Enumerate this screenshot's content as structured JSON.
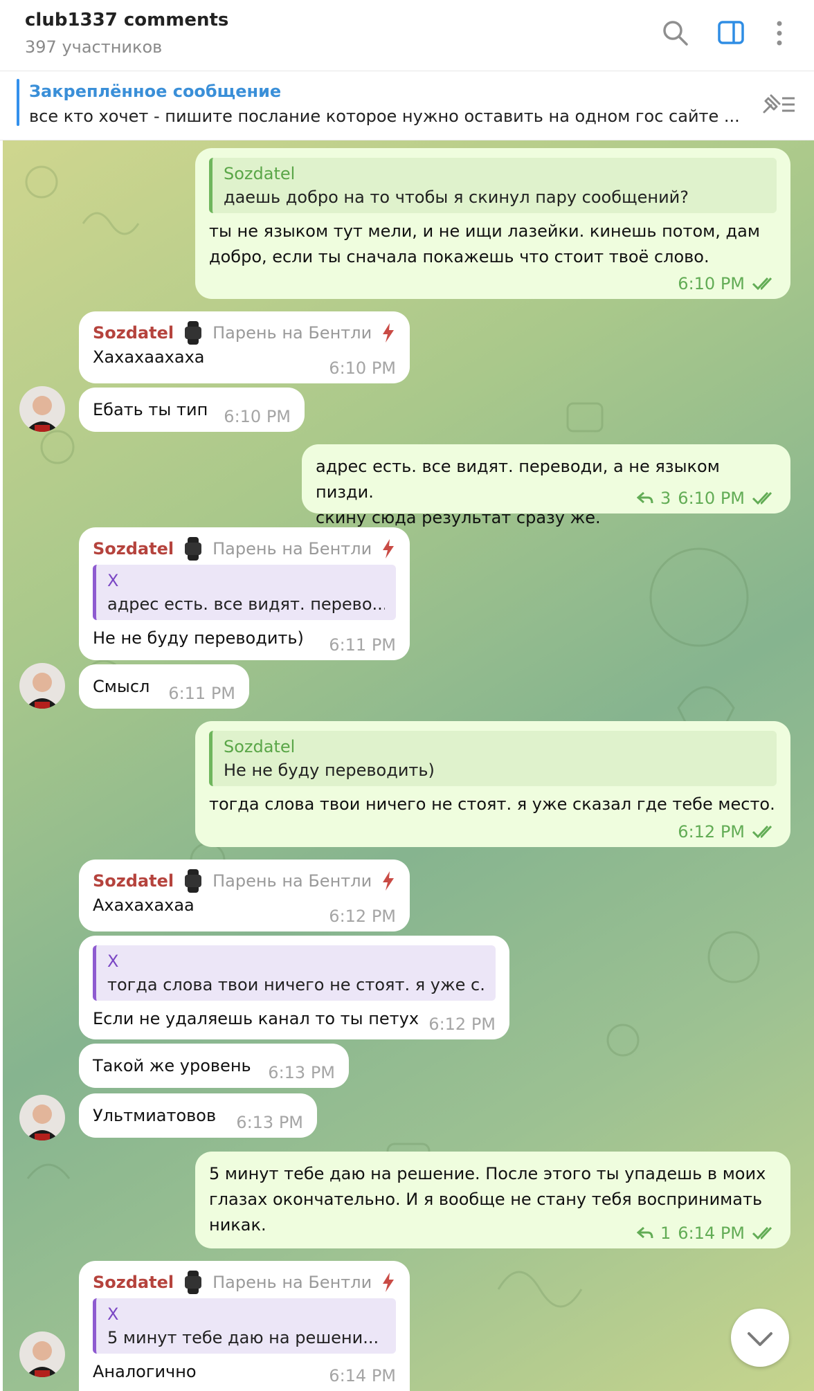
{
  "header": {
    "title": "club1337 comments",
    "subtitle": "397 участников",
    "icons": [
      "search-icon",
      "sidebar-icon",
      "more-icon"
    ]
  },
  "pinned": {
    "title": "Закреплённое сообщение",
    "text": "все кто хочет - пишите послание которое нужно оставить на одном гос сайте ...",
    "icon": "pin-list-icon"
  },
  "colors": {
    "accent": "#3390ec",
    "outgoing": "#effdde",
    "incoming": "#ffffff",
    "sender": "#b5433d",
    "check": "#62ac55"
  },
  "messages": [
    {
      "quote_name": "Sozdatel",
      "quote_text": "даешь добро на то чтобы я скинул пару сообщений?",
      "text": "ты не языком тут мели, и не ищи лазейки. кинешь потом, дам\nдобро, если ты сначала покажешь что стоит твоё слово.",
      "time": "6:10 PM"
    },
    {
      "sender": "Sozdatel",
      "rank": "Парень на Бентли",
      "text": "Хахахаахаха",
      "time": "6:10 PM"
    },
    {
      "text": "Ебать ты тип",
      "time": "6:10 PM"
    },
    {
      "text": "адрес есть. все видят. переводи, а не языком пизди.\nскину сюда результат сразу же.",
      "replies": "3",
      "time": "6:10 PM"
    },
    {
      "sender": "Sozdatel",
      "rank": "Парень на Бентли",
      "quote_name": "X",
      "quote_text": "адрес есть. все видят. перево...",
      "text": "Не не буду переводить)",
      "time": "6:11 PM"
    },
    {
      "text": "Смысл",
      "time": "6:11 PM"
    },
    {
      "quote_name": "Sozdatel",
      "quote_text": "Не не буду переводить)",
      "text": "тогда слова твои ничего не стоят. я уже сказал где тебе место.",
      "time": "6:12 PM"
    },
    {
      "sender": "Sozdatel",
      "rank": "Парень на Бентли",
      "text": "Ахахахахаа",
      "time": "6:12 PM"
    },
    {
      "quote_name": "X",
      "quote_text": "тогда слова твои ничего не стоят. я уже с...",
      "text": "Если не удаляешь канал то ты петух",
      "time": "6:12 PM"
    },
    {
      "text": "Такой же уровень",
      "time": "6:13 PM"
    },
    {
      "text": "Ультмиатовов",
      "time": "6:13 PM"
    },
    {
      "text": "5 минут тебе даю на решение. После этого ты упадешь в моих\nглазах окончательно. И я вообще не стану тебя воспринимать\nникак.",
      "replies": "1",
      "time": "6:14 PM"
    },
    {
      "sender": "Sozdatel",
      "rank": "Парень на Бентли",
      "quote_name": "X",
      "quote_text": "5 минут тебе даю на решени...",
      "text": "Аналогично",
      "time": "6:14 PM"
    }
  ]
}
